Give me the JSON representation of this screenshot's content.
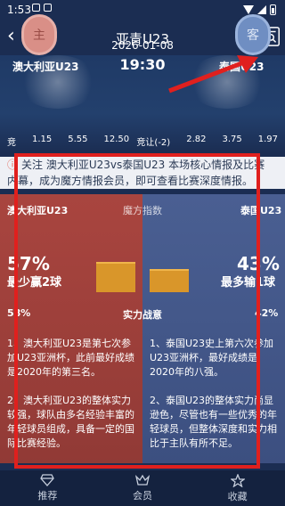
{
  "status": {
    "time": "1:53"
  },
  "nav": {
    "title": "亚青U23",
    "back_icon": "chevron-left-icon",
    "share_icon": "share-icon",
    "doc_icon": "document-search-icon"
  },
  "match": {
    "date": "2026-01-08",
    "time": "19:30",
    "home": {
      "badge": "主",
      "name": "澳大利亚U23"
    },
    "away": {
      "badge": "客",
      "name": "泰国U23"
    }
  },
  "odds": {
    "left_label": "竞",
    "left": [
      "1.15",
      "5.55",
      "12.50"
    ],
    "mid_label": "竞让(-2)",
    "right": [
      "2.82",
      "3.75",
      "1.97"
    ]
  },
  "notice": {
    "icon": "info-icon",
    "line1": "关注 澳大利亚U23vs泰国U23 本场核心情报及比赛",
    "line2": "内幕，成为魔方情报会员，即可查看比赛深度情报。"
  },
  "magic": {
    "home_team": "澳大利亚U23",
    "away_team": "泰国U23",
    "center": "魔方指数",
    "home_pct": "57%",
    "home_result": "最少赢2球",
    "away_pct": "43%",
    "away_result": "最多输1球",
    "home_bar": 0.57,
    "away_bar": 0.43,
    "colors": {
      "home": "#a9453f",
      "away": "#4a5f92",
      "bar": "#d9962a"
    }
  },
  "form": {
    "home_pct": "58%",
    "center": "实力战意",
    "away_pct": "42%"
  },
  "analysis": {
    "home_1": "1、澳大利亚U23是第七次参加U23亚洲杯，此前最好成绩是2020年的第三名。",
    "away_1": "1、泰国U23史上第六次参加U23亚洲杯，最好成绩是2020年的八强。",
    "home_2": "2、澳大利亚U23的整体实力较强，球队由多名经验丰富的年轻球员组成，具备一定的国际比赛经验。",
    "away_2": "2、泰国U23的整体实力尚显逊色，尽管也有一些优秀的年轻球员，但整体深度和实力相比于主队有所不足。"
  },
  "tabs": [
    {
      "label": "推荐",
      "icon": "diamond-icon"
    },
    {
      "label": "会员",
      "icon": "crown-icon"
    },
    {
      "label": "收藏",
      "icon": "star-icon"
    }
  ]
}
